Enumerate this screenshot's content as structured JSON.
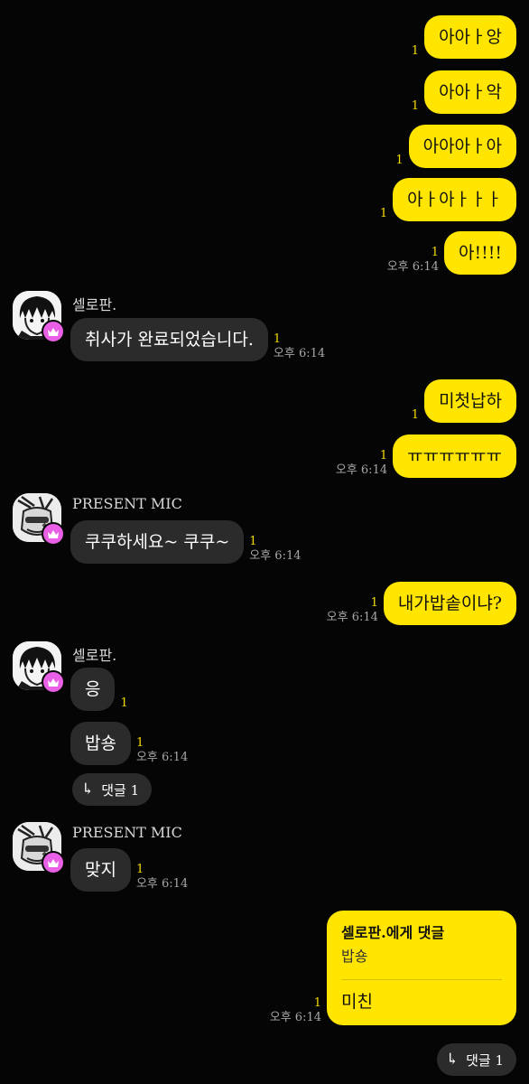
{
  "messages_out_1": [
    {
      "text": "아아ㅏ앙",
      "unread": "1"
    },
    {
      "text": "아아ㅏ악",
      "unread": "1"
    },
    {
      "text": "아아아ㅏ아",
      "unread": "1"
    },
    {
      "text": "아ㅏ아ㅏㅏㅏ",
      "unread": "1"
    },
    {
      "text": "아!!!!",
      "unread": "1",
      "time": "오후 6:14"
    }
  ],
  "msg_in_1": {
    "sender": "셀로판.",
    "text": "취사가 완료되었습니다.",
    "unread": "1",
    "time": "오후 6:14"
  },
  "messages_out_2": [
    {
      "text": "미첫납하",
      "unread": "1"
    },
    {
      "text": "ㅠㅠㅠㅠㅠㅠ",
      "unread": "1",
      "time": "오후 6:14"
    }
  ],
  "msg_in_2": {
    "sender": "PRESENT MIC",
    "text": "쿠쿠하세요~ 쿠쿠~",
    "unread": "1",
    "time": "오후 6:14"
  },
  "msg_out_3": {
    "text": "내가밥솥이냐?",
    "unread": "1",
    "time": "오후 6:14"
  },
  "msg_in_3": {
    "sender": "셀로판.",
    "bubble_1": {
      "text": "응",
      "unread": "1"
    },
    "bubble_2": {
      "text": "밥숑",
      "unread": "1",
      "time": "오후 6:14"
    },
    "reply_chip": "댓글 1"
  },
  "msg_in_4": {
    "sender": "PRESENT MIC",
    "text": "맞지",
    "unread": "1",
    "time": "오후 6:14"
  },
  "msg_out_reply": {
    "title": "셀로판.에게 댓글",
    "quote": "밥숑",
    "text": "미친",
    "unread": "1",
    "time": "오후 6:14",
    "reply_chip": "댓글 1"
  },
  "colors": {
    "bubble_out": "#ffe500",
    "bubble_in": "#2b2b2b",
    "unread": "#f5dc00",
    "badge": "#e95fe6",
    "background": "#050505"
  },
  "icons": {
    "badge": "crown-icon",
    "reply": "reply-arrow-icon"
  }
}
